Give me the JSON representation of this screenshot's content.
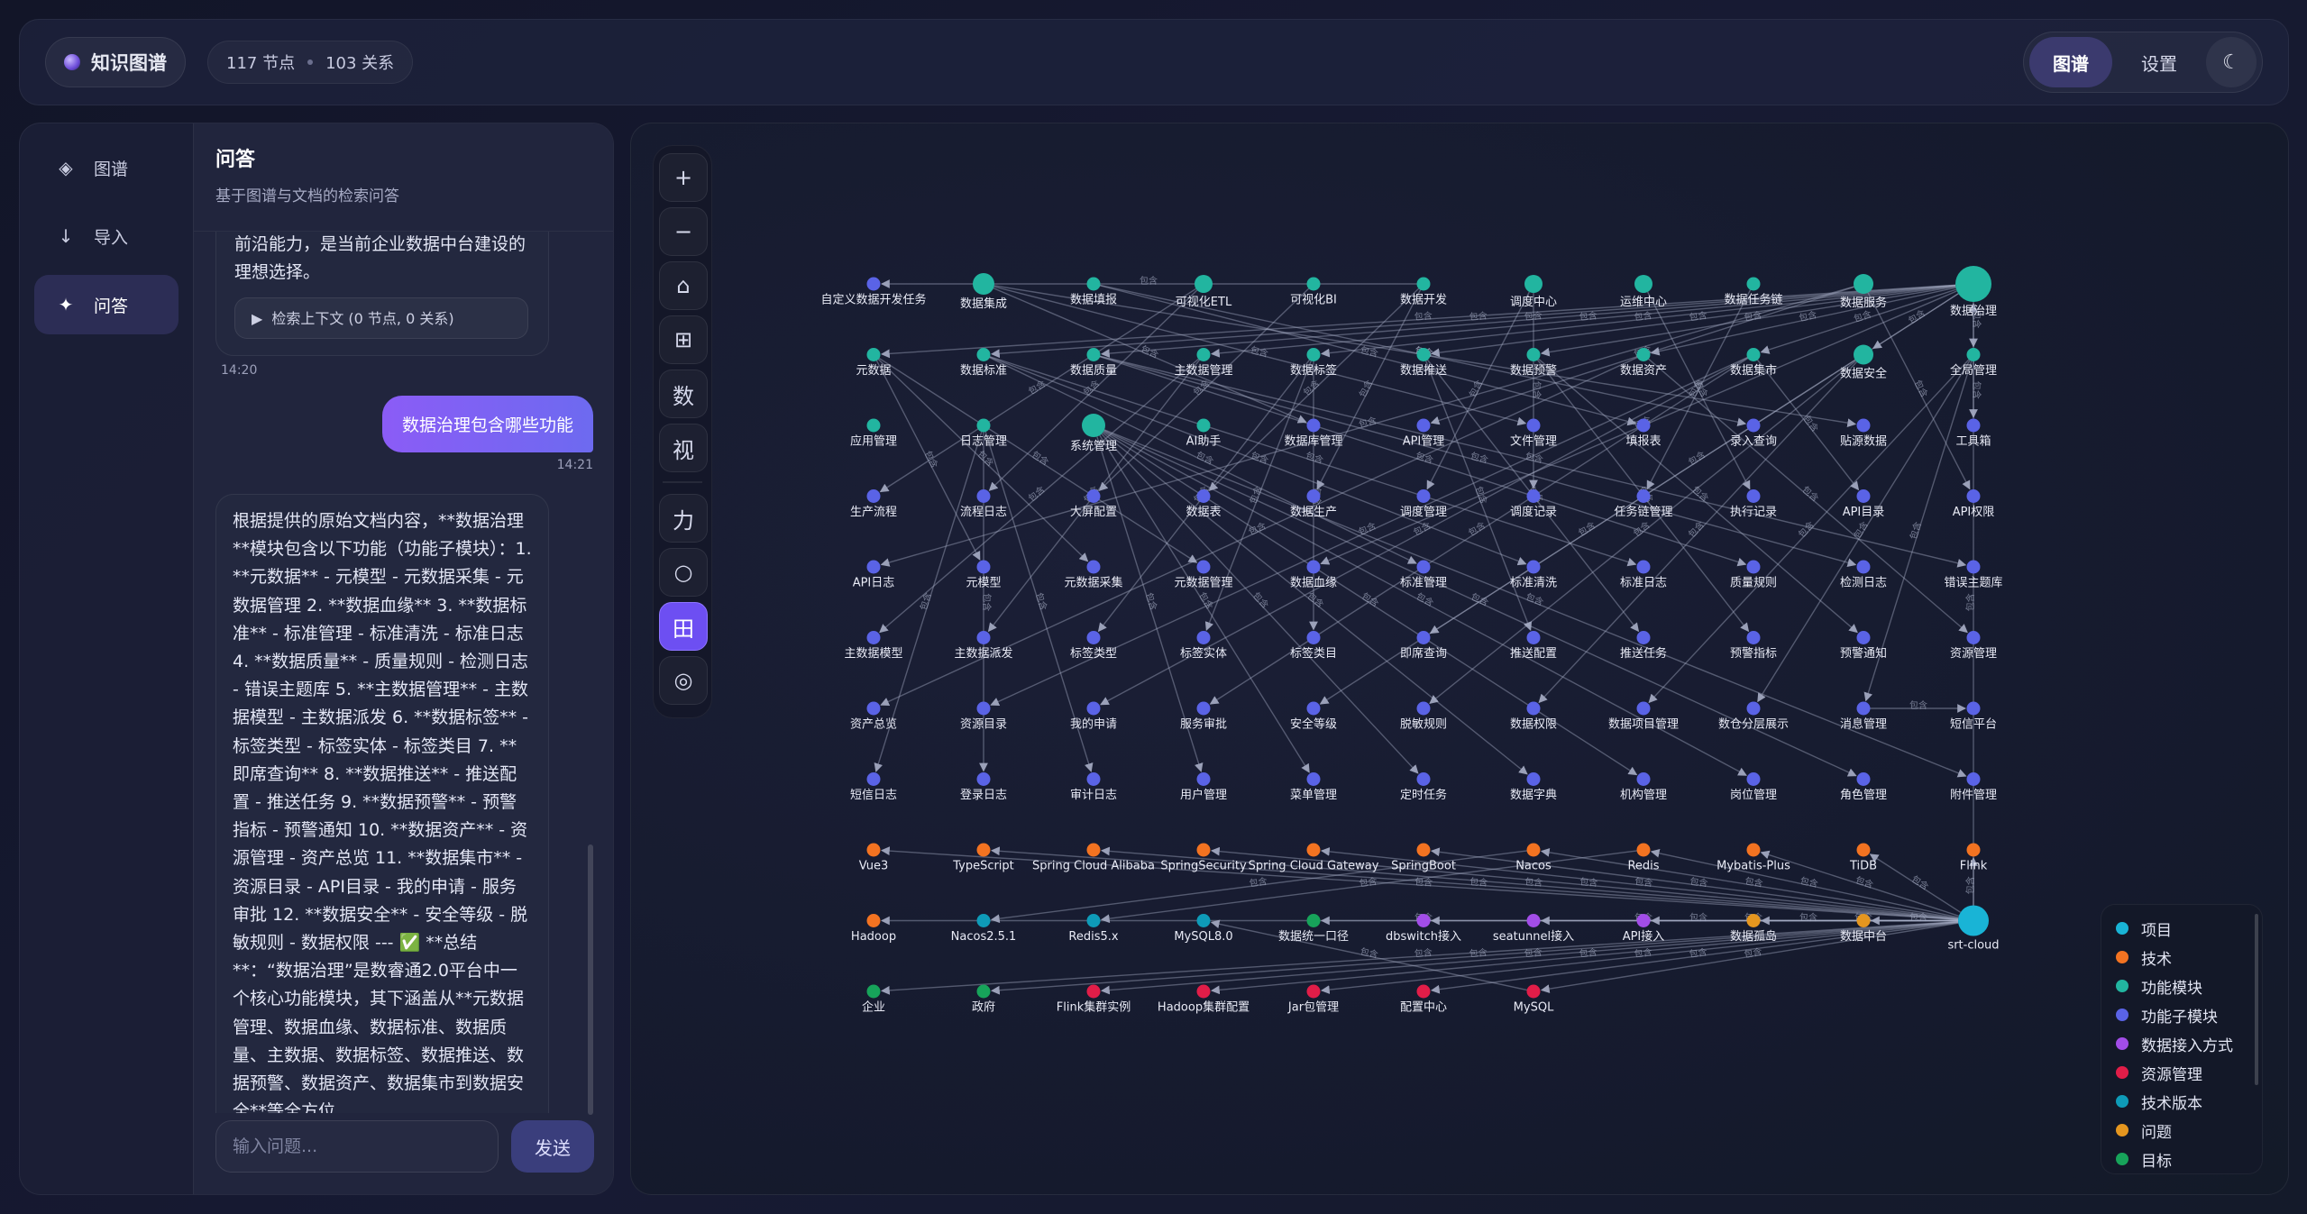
{
  "header": {
    "brand": "知识图谱",
    "node_count": "117 节点",
    "relation_count": "103 关系",
    "nav": [
      {
        "label": "图谱",
        "active": true
      },
      {
        "label": "设置",
        "active": false
      }
    ],
    "theme_icon": "☾"
  },
  "sidebar": {
    "items": [
      {
        "label": "图谱",
        "icon": "◈",
        "icon_name": "graph-icon"
      },
      {
        "label": "导入",
        "icon": "↓",
        "icon_name": "import-icon"
      },
      {
        "label": "问答",
        "icon": "✦",
        "icon_name": "sparkle-icon",
        "active": true
      }
    ]
  },
  "chat": {
    "title": "问答",
    "subtitle": "基于图谱与文档的检索问答",
    "messages": {
      "assistant_prev_tail": "前沿能力，是当前企业数据中台建设的理想选择。",
      "context_label": "检索上下文 (0 节点, 0 关系)",
      "assistant_prev_time": "14:20",
      "user_question": "数据治理包含哪些功能",
      "user_time": "14:21",
      "assistant_answer": "根据提供的原始文档内容，**数据治理**模块包含以下功能（功能子模块）：1. **元数据** - 元模型 - 元数据采集 - 元数据管理 2. **数据血缘** 3. **数据标准** - 标准管理 - 标准清洗 - 标准日志 4. **数据质量** - 质量规则 - 检测日志 - 错误主题库 5. **主数据管理** - 主数据模型 - 主数据派发 6. **数据标签** - 标签类型 - 标签实体 - 标签类目 7. **即席查询** 8. **数据推送** - 推送配置 - 推送任务 9. **数据预警** - 预警指标 - 预警通知 10. **数据资产** - 资源管理 - 资产总览 11. **数据集市** - 资源目录 - API目录 - 我的申请 - 服务审批 12. **数据安全** - 安全等级 - 脱敏规则 - 数据权限 --- ✅ **总结**：“数据治理”是数睿通2.0平台中一个核心功能模块，其下涵盖从**元数据管理、数据血缘、数据标准、数据质量、主数据、数据标签、数据推送、数据预警、数据资产、数据集市到数据安全**等全方位"
    },
    "input_placeholder": "输入问题...",
    "send_label": "发送"
  },
  "toolbar": [
    {
      "glyph": "+",
      "name": "zoom-in-button"
    },
    {
      "glyph": "−",
      "name": "zoom-out-button"
    },
    {
      "glyph": "⌂",
      "name": "home-button"
    },
    {
      "glyph": "⊞",
      "name": "fit-view-button"
    },
    {
      "glyph": "数",
      "name": "data-view-button"
    },
    {
      "glyph": "视",
      "name": "visual-view-button"
    },
    {
      "glyph": "力",
      "name": "force-layout-button"
    },
    {
      "glyph": "○",
      "name": "circular-layout-button"
    },
    {
      "glyph": "田",
      "name": "grid-layout-button",
      "active": true
    },
    {
      "glyph": "◎",
      "name": "radial-layout-button"
    }
  ],
  "colors": {
    "项目": "#19b4d6",
    "技术": "#f37321",
    "功能模块": "#22b5a0",
    "功能子模块": "#5a63e6",
    "数据接入方式": "#a24de8",
    "资源管理": "#e11d48",
    "技术版本": "#0e9bb8",
    "问题": "#e5961f",
    "目标": "#17a35a"
  },
  "legend": [
    "项目",
    "技术",
    "功能模块",
    "功能子模块",
    "数据接入方式",
    "资源管理",
    "技术版本",
    "问题",
    "目标"
  ],
  "graph": {
    "edge_label": "包含",
    "rows": [
      [
        [
          "自定义数据开发任务",
          "功能子模块"
        ],
        [
          "数据集成",
          "功能模块"
        ],
        [
          "数据填报",
          "功能模块"
        ],
        [
          "可视化ETL",
          "功能模块"
        ],
        [
          "可视化BI",
          "功能模块"
        ],
        [
          "数据开发",
          "功能模块"
        ],
        [
          "调度中心",
          "功能模块"
        ],
        [
          "运维中心",
          "功能模块"
        ],
        [
          "数据任务链",
          "功能模块"
        ],
        [
          "数据服务",
          "功能模块"
        ],
        [
          "数据治理",
          "功能模块"
        ]
      ],
      [
        [
          "元数据",
          "功能模块"
        ],
        [
          "数据标准",
          "功能模块"
        ],
        [
          "数据质量",
          "功能模块"
        ],
        [
          "主数据管理",
          "功能模块"
        ],
        [
          "数据标签",
          "功能模块"
        ],
        [
          "数据推送",
          "功能模块"
        ],
        [
          "数据预警",
          "功能模块"
        ],
        [
          "数据资产",
          "功能模块"
        ],
        [
          "数据集市",
          "功能模块"
        ],
        [
          "数据安全",
          "功能模块"
        ],
        [
          "全局管理",
          "功能模块"
        ]
      ],
      [
        [
          "应用管理",
          "功能模块"
        ],
        [
          "日志管理",
          "功能模块"
        ],
        [
          "系统管理",
          "功能模块"
        ],
        [
          "AI助手",
          "功能模块"
        ],
        [
          "数据库管理",
          "功能子模块"
        ],
        [
          "API管理",
          "功能子模块"
        ],
        [
          "文件管理",
          "功能子模块"
        ],
        [
          "填报表",
          "功能子模块"
        ],
        [
          "录入查询",
          "功能子模块"
        ],
        [
          "贴源数据",
          "功能子模块"
        ],
        [
          "工具箱",
          "功能子模块"
        ]
      ],
      [
        [
          "生产流程",
          "功能子模块"
        ],
        [
          "流程日志",
          "功能子模块"
        ],
        [
          "大屏配置",
          "功能子模块"
        ],
        [
          "数据表",
          "功能子模块"
        ],
        [
          "数据生产",
          "功能子模块"
        ],
        [
          "调度管理",
          "功能子模块"
        ],
        [
          "调度记录",
          "功能子模块"
        ],
        [
          "任务链管理",
          "功能子模块"
        ],
        [
          "执行记录",
          "功能子模块"
        ],
        [
          "API目录",
          "功能子模块"
        ],
        [
          "API权限",
          "功能子模块"
        ]
      ],
      [
        [
          "API日志",
          "功能子模块"
        ],
        [
          "元模型",
          "功能子模块"
        ],
        [
          "元数据采集",
          "功能子模块"
        ],
        [
          "元数据管理",
          "功能子模块"
        ],
        [
          "数据血缘",
          "功能子模块"
        ],
        [
          "标准管理",
          "功能子模块"
        ],
        [
          "标准清洗",
          "功能子模块"
        ],
        [
          "标准日志",
          "功能子模块"
        ],
        [
          "质量规则",
          "功能子模块"
        ],
        [
          "检测日志",
          "功能子模块"
        ],
        [
          "错误主题库",
          "功能子模块"
        ]
      ],
      [
        [
          "主数据模型",
          "功能子模块"
        ],
        [
          "主数据派发",
          "功能子模块"
        ],
        [
          "标签类型",
          "功能子模块"
        ],
        [
          "标签实体",
          "功能子模块"
        ],
        [
          "标签类目",
          "功能子模块"
        ],
        [
          "即席查询",
          "功能子模块"
        ],
        [
          "推送配置",
          "功能子模块"
        ],
        [
          "推送任务",
          "功能子模块"
        ],
        [
          "预警指标",
          "功能子模块"
        ],
        [
          "预警通知",
          "功能子模块"
        ],
        [
          "资源管理",
          "功能子模块"
        ]
      ],
      [
        [
          "资产总览",
          "功能子模块"
        ],
        [
          "资源目录",
          "功能子模块"
        ],
        [
          "我的申请",
          "功能子模块"
        ],
        [
          "服务审批",
          "功能子模块"
        ],
        [
          "安全等级",
          "功能子模块"
        ],
        [
          "脱敏规则",
          "功能子模块"
        ],
        [
          "数据权限",
          "功能子模块"
        ],
        [
          "数据项目管理",
          "功能子模块"
        ],
        [
          "数仓分层展示",
          "功能子模块"
        ],
        [
          "消息管理",
          "功能子模块"
        ],
        [
          "短信平台",
          "功能子模块"
        ]
      ],
      [
        [
          "短信日志",
          "功能子模块"
        ],
        [
          "登录日志",
          "功能子模块"
        ],
        [
          "审计日志",
          "功能子模块"
        ],
        [
          "用户管理",
          "功能子模块"
        ],
        [
          "菜单管理",
          "功能子模块"
        ],
        [
          "定时任务",
          "功能子模块"
        ],
        [
          "数据字典",
          "功能子模块"
        ],
        [
          "机构管理",
          "功能子模块"
        ],
        [
          "岗位管理",
          "功能子模块"
        ],
        [
          "角色管理",
          "功能子模块"
        ],
        [
          "附件管理",
          "功能子模块"
        ]
      ],
      [
        [
          "Vue3",
          "技术"
        ],
        [
          "TypeScript",
          "技术"
        ],
        [
          "Spring Cloud Alibaba",
          "技术"
        ],
        [
          "SpringSecurity",
          "技术"
        ],
        [
          "Spring Cloud Gateway",
          "技术"
        ],
        [
          "SpringBoot",
          "技术"
        ],
        [
          "Nacos",
          "技术"
        ],
        [
          "Redis",
          "技术"
        ],
        [
          "Mybatis-Plus",
          "技术"
        ],
        [
          "TiDB",
          "技术"
        ],
        [
          "Flink",
          "技术"
        ]
      ],
      [
        [
          "Hadoop",
          "技术"
        ],
        [
          "Nacos2.5.1",
          "技术版本"
        ],
        [
          "Redis5.x",
          "技术版本"
        ],
        [
          "MySQL8.0",
          "技术版本"
        ],
        [
          "数据统一口径",
          "目标"
        ],
        [
          "dbswitch接入",
          "数据接入方式"
        ],
        [
          "seatunnel接入",
          "数据接入方式"
        ],
        [
          "API接入",
          "数据接入方式"
        ],
        [
          "数据孤岛",
          "问题"
        ],
        [
          "数据中台",
          "问题"
        ],
        [
          "srt-cloud",
          "项目"
        ]
      ],
      [
        [
          "企业",
          "目标"
        ],
        [
          "政府",
          "目标"
        ],
        [
          "Flink集群实例",
          "资源管理"
        ],
        [
          "Hadoop集群配置",
          "资源管理"
        ],
        [
          "Jar包管理",
          "资源管理"
        ],
        [
          "配置中心",
          "资源管理"
        ],
        [
          "MySQL",
          "资源管理"
        ]
      ]
    ]
  }
}
